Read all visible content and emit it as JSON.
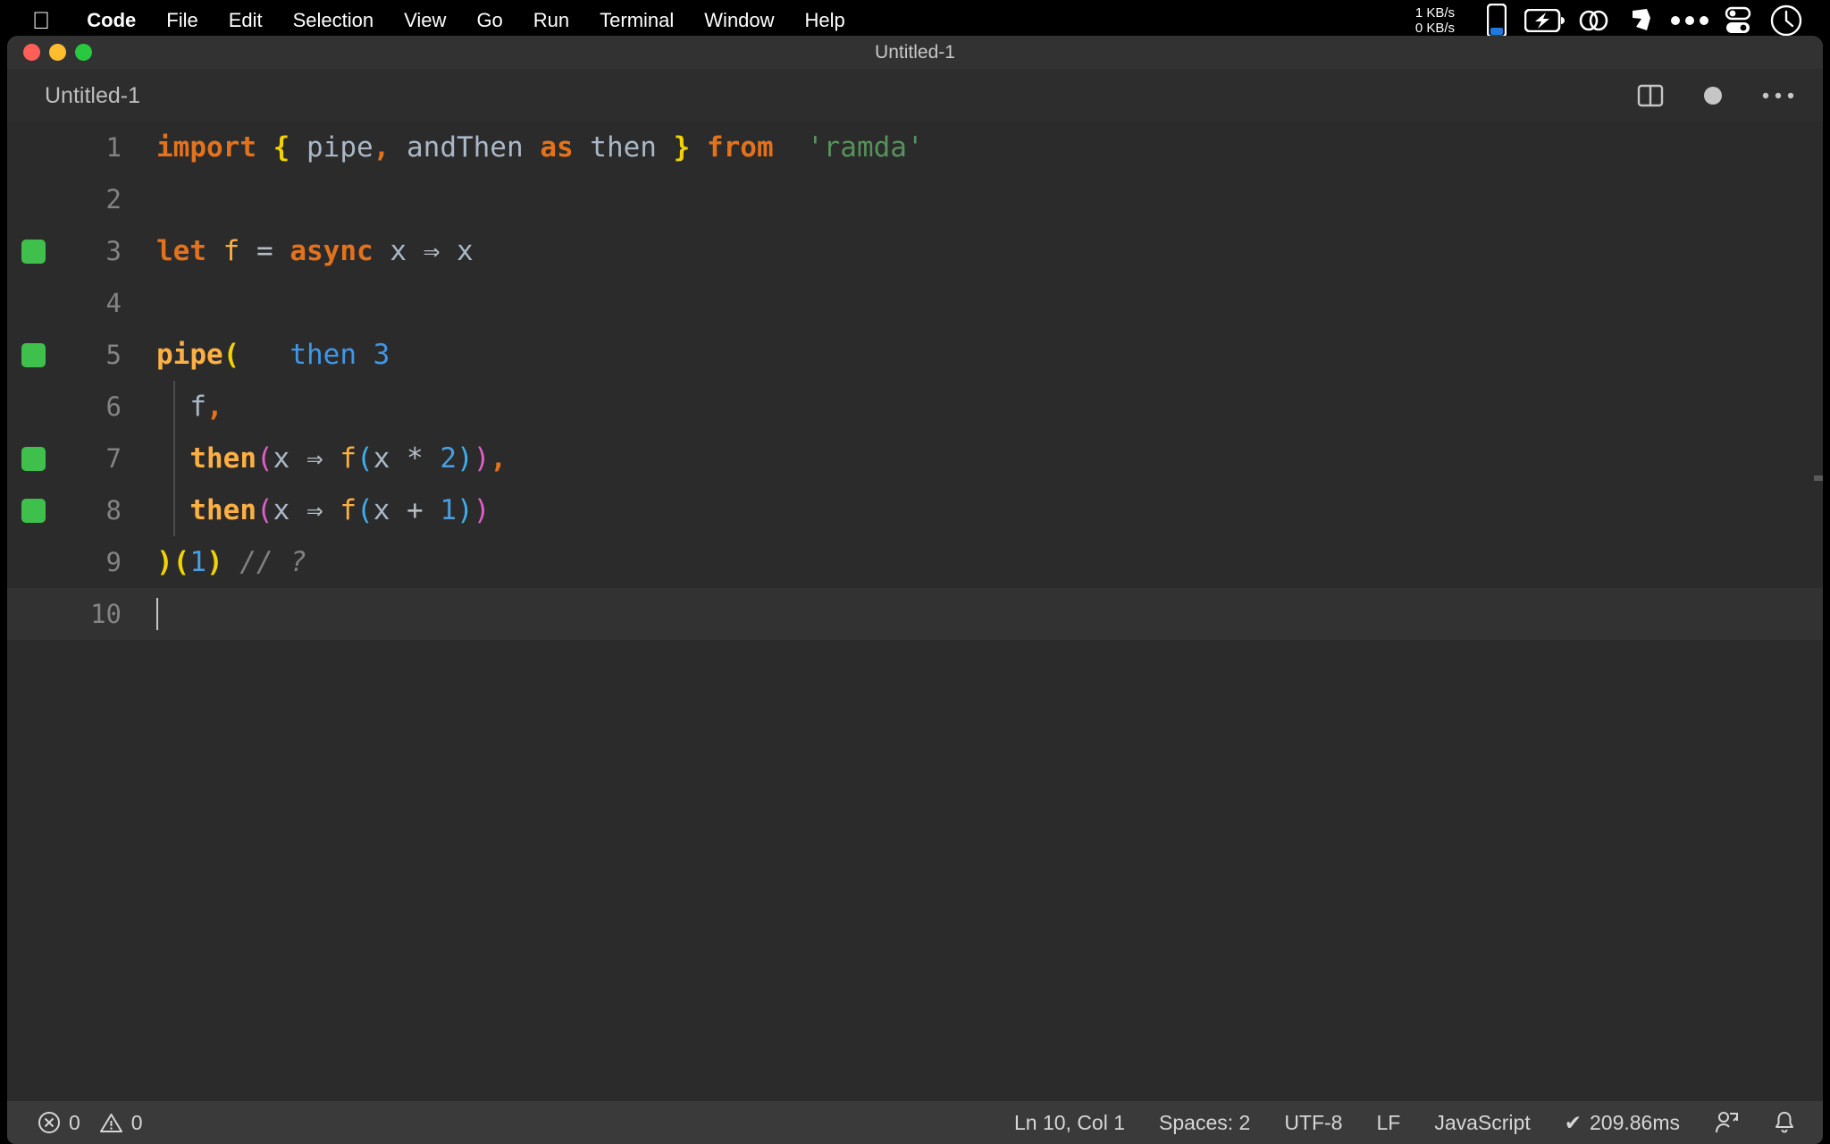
{
  "menubar": {
    "apple_icon": "apple-logo-icon",
    "items": [
      {
        "label": "Code",
        "bold": true
      },
      {
        "label": "File",
        "bold": false
      },
      {
        "label": "Edit",
        "bold": false
      },
      {
        "label": "Selection",
        "bold": false
      },
      {
        "label": "View",
        "bold": false
      },
      {
        "label": "Go",
        "bold": false
      },
      {
        "label": "Run",
        "bold": false
      },
      {
        "label": "Terminal",
        "bold": false
      },
      {
        "label": "Window",
        "bold": false
      },
      {
        "label": "Help",
        "bold": false
      }
    ],
    "network": {
      "up": "1 KB/s",
      "down": "0 KB/s"
    },
    "tray_icons": [
      "phone-battery-icon",
      "battery-charging-icon",
      "link-chain-icon",
      "dropbox-icon",
      "ellipsis-icon",
      "toggles-icon",
      "clock-icon"
    ]
  },
  "window": {
    "title": "Untitled-1",
    "traffic_lights": [
      "close-red",
      "minimize-yellow",
      "maximize-green"
    ]
  },
  "editor": {
    "tab_label": "Untitled-1",
    "actions": [
      "split-editor-icon",
      "unsaved-dot-icon",
      "more-actions-icon"
    ],
    "lines": [
      {
        "num": "1",
        "breakpoint": false,
        "current": false,
        "indent_guide": false,
        "tokens": [
          {
            "t": "import",
            "c": "kw"
          },
          {
            "t": " ",
            "c": "plain"
          },
          {
            "t": "{",
            "c": "by-b"
          },
          {
            "t": " ",
            "c": "plain"
          },
          {
            "t": "pipe",
            "c": "plain"
          },
          {
            "t": ",",
            "c": "kw"
          },
          {
            "t": " andThen ",
            "c": "plain"
          },
          {
            "t": "as",
            "c": "kw"
          },
          {
            "t": " then ",
            "c": "plain"
          },
          {
            "t": "}",
            "c": "by-b"
          },
          {
            "t": " ",
            "c": "plain"
          },
          {
            "t": "from",
            "c": "kw"
          },
          {
            "t": "  ",
            "c": "plain"
          },
          {
            "t": "'ramda'",
            "c": "str"
          }
        ]
      },
      {
        "num": "2",
        "breakpoint": false,
        "current": false,
        "indent_guide": false,
        "tokens": []
      },
      {
        "num": "3",
        "breakpoint": true,
        "current": false,
        "indent_guide": false,
        "tokens": [
          {
            "t": "let",
            "c": "kw"
          },
          {
            "t": " ",
            "c": "plain"
          },
          {
            "t": "f",
            "c": "fn"
          },
          {
            "t": " ",
            "c": "plain"
          },
          {
            "t": "=",
            "c": "op"
          },
          {
            "t": " ",
            "c": "plain"
          },
          {
            "t": "async",
            "c": "kw"
          },
          {
            "t": " ",
            "c": "plain"
          },
          {
            "t": "x",
            "c": "plain"
          },
          {
            "t": " ",
            "c": "plain"
          },
          {
            "t": "⇒",
            "c": "op"
          },
          {
            "t": " ",
            "c": "plain"
          },
          {
            "t": "x",
            "c": "plain"
          }
        ]
      },
      {
        "num": "4",
        "breakpoint": false,
        "current": false,
        "indent_guide": false,
        "tokens": []
      },
      {
        "num": "5",
        "breakpoint": true,
        "current": false,
        "indent_guide": false,
        "tokens": [
          {
            "t": "pipe",
            "c": "fnb"
          },
          {
            "t": "(",
            "c": "by-b"
          },
          {
            "t": "   ",
            "c": "plain"
          },
          {
            "t": "then 3",
            "c": "hint"
          }
        ]
      },
      {
        "num": "6",
        "breakpoint": false,
        "current": false,
        "indent_guide": true,
        "tokens": [
          {
            "t": "  ",
            "c": "plain"
          },
          {
            "t": "f",
            "c": "plain"
          },
          {
            "t": ",",
            "c": "kw"
          }
        ]
      },
      {
        "num": "7",
        "breakpoint": true,
        "current": false,
        "indent_guide": true,
        "tokens": [
          {
            "t": "  ",
            "c": "plain"
          },
          {
            "t": "then",
            "c": "fnb"
          },
          {
            "t": "(",
            "c": "bm"
          },
          {
            "t": "x",
            "c": "plain"
          },
          {
            "t": " ",
            "c": "plain"
          },
          {
            "t": "⇒",
            "c": "op"
          },
          {
            "t": " ",
            "c": "plain"
          },
          {
            "t": "f",
            "c": "fn"
          },
          {
            "t": "(",
            "c": "bc"
          },
          {
            "t": "x",
            "c": "plain"
          },
          {
            "t": " ",
            "c": "plain"
          },
          {
            "t": "*",
            "c": "op"
          },
          {
            "t": " ",
            "c": "plain"
          },
          {
            "t": "2",
            "c": "num"
          },
          {
            "t": ")",
            "c": "bc"
          },
          {
            "t": ")",
            "c": "bm"
          },
          {
            "t": ",",
            "c": "kw"
          }
        ]
      },
      {
        "num": "8",
        "breakpoint": true,
        "current": false,
        "indent_guide": true,
        "tokens": [
          {
            "t": "  ",
            "c": "plain"
          },
          {
            "t": "then",
            "c": "fnb"
          },
          {
            "t": "(",
            "c": "bm"
          },
          {
            "t": "x",
            "c": "plain"
          },
          {
            "t": " ",
            "c": "plain"
          },
          {
            "t": "⇒",
            "c": "op"
          },
          {
            "t": " ",
            "c": "plain"
          },
          {
            "t": "f",
            "c": "fn"
          },
          {
            "t": "(",
            "c": "bc"
          },
          {
            "t": "x",
            "c": "plain"
          },
          {
            "t": " ",
            "c": "plain"
          },
          {
            "t": "+",
            "c": "op"
          },
          {
            "t": " ",
            "c": "plain"
          },
          {
            "t": "1",
            "c": "num"
          },
          {
            "t": ")",
            "c": "bc"
          },
          {
            "t": ")",
            "c": "bm"
          }
        ]
      },
      {
        "num": "9",
        "breakpoint": false,
        "current": false,
        "indent_guide": false,
        "tokens": [
          {
            "t": ")",
            "c": "by-b"
          },
          {
            "t": "(",
            "c": "by-b"
          },
          {
            "t": "1",
            "c": "num"
          },
          {
            "t": ")",
            "c": "by-b"
          },
          {
            "t": " ",
            "c": "plain"
          },
          {
            "t": "// ?",
            "c": "cmt"
          }
        ]
      },
      {
        "num": "10",
        "breakpoint": false,
        "current": true,
        "indent_guide": false,
        "tokens": []
      }
    ]
  },
  "statusbar": {
    "errors": "0",
    "warnings": "0",
    "position": "Ln 10, Col 1",
    "indentation": "Spaces: 2",
    "encoding": "UTF-8",
    "eol": "LF",
    "language": "JavaScript",
    "run_time": "209.86ms",
    "run_check": "✔",
    "icons": [
      "error-circle-icon",
      "warning-triangle-icon",
      "remote-account-icon",
      "bell-icon"
    ]
  },
  "colors": {
    "window_bg": "#252526",
    "editor_bg": "#2b2b2b",
    "titlebar_bg": "#323233",
    "statusbar_bg": "#3a3a3a",
    "keyword": "#e2721d",
    "string": "#57925b",
    "number": "#4a9ede",
    "function": "#fcb043",
    "comment": "#808080",
    "bracket_yellow": "#f2d200",
    "bracket_magenta": "#e060c8",
    "bracket_cyan": "#3fb0ef",
    "inlay_hint": "#3f97e8",
    "breakpoint_green": "#3fbf4b"
  }
}
